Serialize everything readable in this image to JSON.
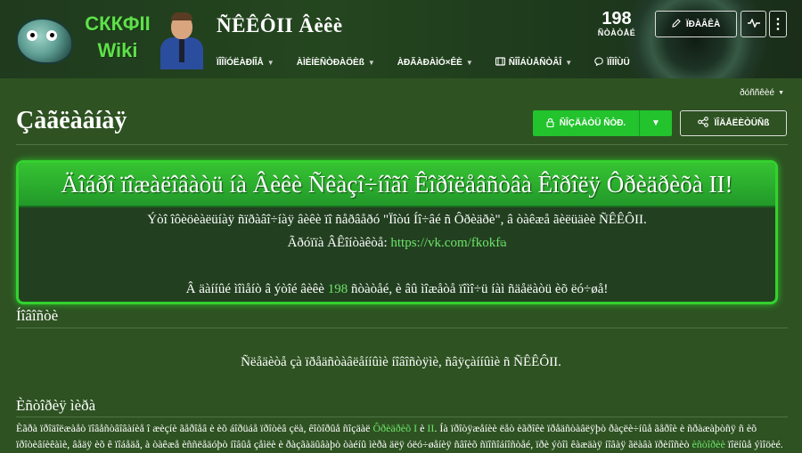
{
  "header": {
    "logo_text_line1": "СККФII",
    "logo_text_line2": "Wiki",
    "site_title": "ÑÊÊÔII Âèêè",
    "nav": [
      {
        "label": "ÏÎÎÏÓËÀÐÍÎÅ",
        "icon": "",
        "has_caret": true
      },
      {
        "label": "ÀÌÈÍÈÑÒÐÀÖÈß",
        "icon": "",
        "has_caret": true
      },
      {
        "label": "ÀÐÃÀÐÀÌÓ×ÊÈ",
        "icon": "",
        "has_caret": true
      },
      {
        "label": "ÑÎÎÁÙÅÑÒÂÎ",
        "icon": "community-icon",
        "has_caret": true
      },
      {
        "label": "ÏÎÌÎÙÜ",
        "icon": "help-bubble-icon",
        "has_caret": false
      }
    ],
    "pages_count": "198",
    "pages_label": "ÑÒÀÒÅÉ",
    "edit_button": "ÏÐÀÂÊÀ",
    "activity_icon": "activity-icon",
    "more_icon": "kebab-icon"
  },
  "page": {
    "tools_label": "ðóññêèé",
    "title": "Çàãëàâíàÿ",
    "create_page_button": "ÑÎÇÄÀÒÜ ÑÒÐ.",
    "share_button": "ÏÎÄÅËÈÒÜÑß",
    "accent_color": "#22c32d"
  },
  "welcome": {
    "heading": "Äîáðî ïîæàëîâàòü íà Âèêè Ñêàçî÷íîãî Êîðîëåâñòâà Êîðîëÿ Ôðèäðèõà II!",
    "line1": "Ýòî îôèöèàëüíàÿ ñïðàâî÷íàÿ âèêè ïî ñåðâåðó \"Ïîòú Íî÷âé ñ Ôðèäðè\", â òàêæå ãèëüäèè ÑÊÊÔII.",
    "line2_label": "Ãðóïïà ÂÊîíòàêòå:",
    "line2_link": "https://vk.com/fkokf",
    "line3_prefix": "Â äàííûé ìîìåíò â ýòîé âèêè",
    "line3_count": "198",
    "line3_suffix": "ñòàòåé, è âû ìîæåòå ïîìî÷ü íàì ñäåëàòü èõ ëó÷øå!"
  },
  "news": {
    "heading": "Íîâîñòè",
    "empty_text": "Ñëåäèòå çà ïðåäñòàâëåííûìè íîâîñòÿìè, ñâÿçàííûìè ñ ÑÊÊÔII."
  },
  "history": {
    "heading": "Èñòîðèÿ ìèðà",
    "text_part1": "Èãðà ïðîäîëæàåò ïîâåñòâîâàíèå î æèçíè ãåðîåâ è èõ áîðüáå ïðîòèâ çëà, êîòîðûå ñîçäàë ",
    "link1": "Ôðèäðèõ I",
    "text_part2": " è ",
    "link2": "II",
    "text_part3": ". Íà ïðîòÿæåíèè ëåò èãðîêè ïðåäñòàâëÿþò ðàçëè÷íûå ãåðîè è ñðàæàþòñÿ ñ èõ ïðîòèâíèêàìè, âåäÿ èõ ê ïîáåäå, à òàêæå èññëåäóþò íîâûå çåìëè è ðàçãàäûâàþò òàéíû ìèðà äëÿ óëó÷øåíèÿ ñâîèõ ñïîñîáíîñòåé, ïðè ýòîì êàæäàÿ íîâàÿ ãëàâà ïðèíîñèò ",
    "link3": "èñòîðèè",
    "text_part4": " ïîëíûå ýìîöèé."
  }
}
